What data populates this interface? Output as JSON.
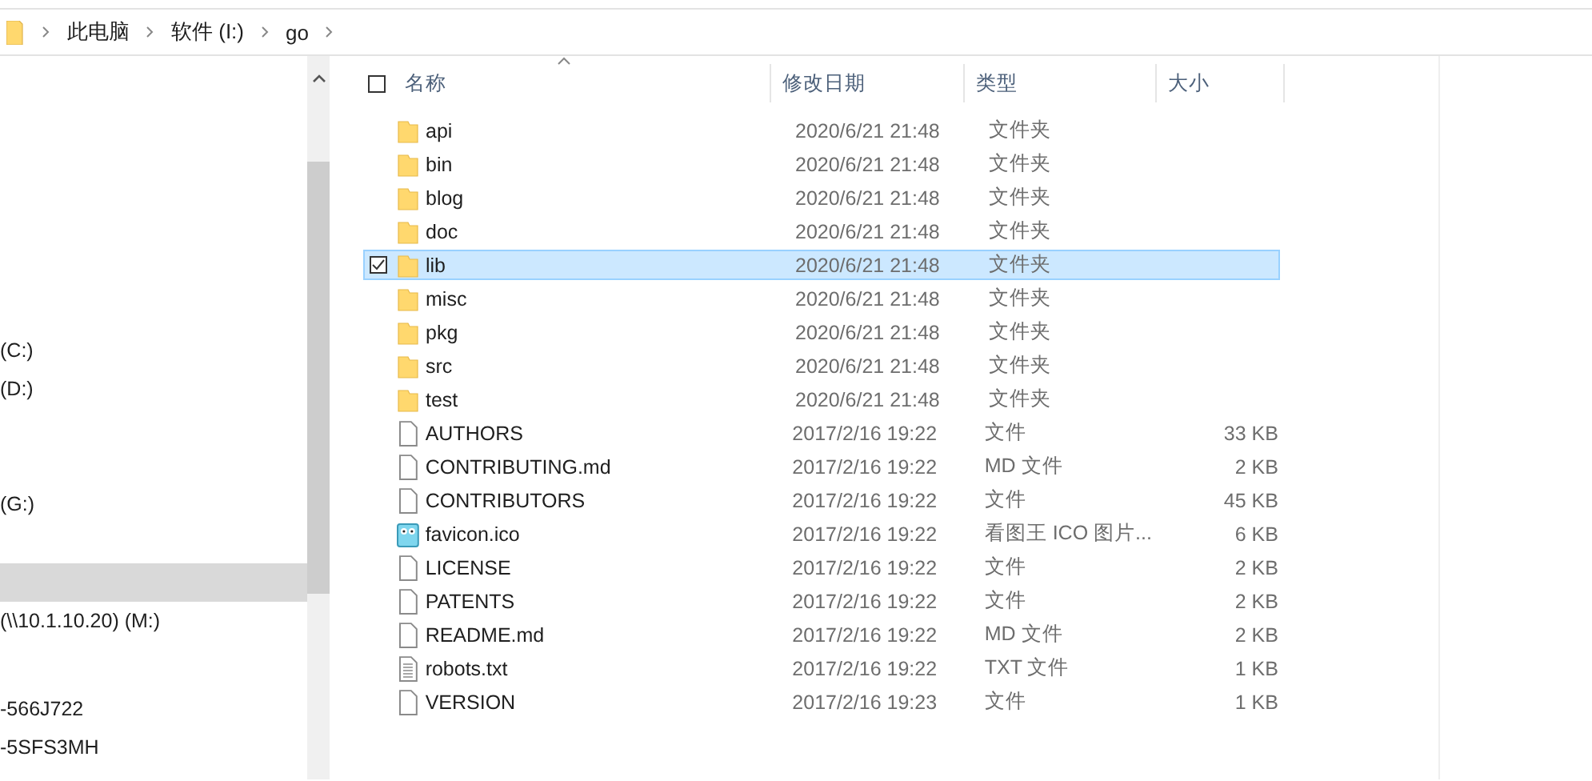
{
  "breadcrumb": [
    "此电脑",
    "软件 (I:)",
    "go"
  ],
  "nav": {
    "items": [
      {
        "label": "(C:)",
        "selected": false
      },
      {
        "label": "(D:)",
        "selected": false
      },
      {
        "label": "(G:)",
        "selected": false
      },
      {
        "selected": true
      },
      {
        "label": "(\\\\10.1.10.20) (M:)",
        "selected": false
      },
      {
        "label": "-566J722",
        "selected": false
      },
      {
        "label": "-5SFS3MH",
        "selected": false
      }
    ]
  },
  "table": {
    "all_checked": false,
    "columns": [
      "名称",
      "修改日期",
      "类型",
      "大小"
    ],
    "rows": [
      {
        "kind": "folder",
        "name": "api",
        "modified": "2020/6/21 21:48",
        "type": "文件夹",
        "selected": false
      },
      {
        "kind": "folder",
        "name": "bin",
        "modified": "2020/6/21 21:48",
        "type": "文件夹",
        "selected": false
      },
      {
        "kind": "folder",
        "name": "blog",
        "modified": "2020/6/21 21:48",
        "type": "文件夹",
        "selected": false
      },
      {
        "kind": "folder",
        "name": "doc",
        "modified": "2020/6/21 21:48",
        "type": "文件夹",
        "selected": false
      },
      {
        "kind": "folder",
        "name": "lib",
        "modified": "2020/6/21 21:48",
        "type": "文件夹",
        "selected": true
      },
      {
        "kind": "folder",
        "name": "misc",
        "modified": "2020/6/21 21:48",
        "type": "文件夹",
        "selected": false
      },
      {
        "kind": "folder",
        "name": "pkg",
        "modified": "2020/6/21 21:48",
        "type": "文件夹",
        "selected": false
      },
      {
        "kind": "folder",
        "name": "src",
        "modified": "2020/6/21 21:48",
        "type": "文件夹",
        "selected": false
      },
      {
        "kind": "folder",
        "name": "test",
        "modified": "2020/6/21 21:48",
        "type": "文件夹",
        "selected": false
      },
      {
        "kind": "file",
        "name": "AUTHORS",
        "modified": "2017/2/16 19:22",
        "type": "文件",
        "size": "33 KB",
        "selected": false
      },
      {
        "kind": "file",
        "name": "CONTRIBUTING.md",
        "modified": "2017/2/16 19:22",
        "type": "MD 文件",
        "size": "2 KB",
        "selected": false
      },
      {
        "kind": "file",
        "name": "CONTRIBUTORS",
        "modified": "2017/2/16 19:22",
        "type": "文件",
        "size": "45 KB",
        "selected": false
      },
      {
        "kind": "image",
        "name": "favicon.ico",
        "modified": "2017/2/16 19:22",
        "type": "看图王 ICO 图片...",
        "size": "6 KB",
        "selected": false
      },
      {
        "kind": "file",
        "name": "LICENSE",
        "modified": "2017/2/16 19:22",
        "type": "文件",
        "size": "2 KB",
        "selected": false
      },
      {
        "kind": "file",
        "name": "PATENTS",
        "modified": "2017/2/16 19:22",
        "type": "文件",
        "size": "2 KB",
        "selected": false
      },
      {
        "kind": "file",
        "name": "README.md",
        "modified": "2017/2/16 19:22",
        "type": "MD 文件",
        "size": "2 KB",
        "selected": false
      },
      {
        "kind": "text",
        "name": "robots.txt",
        "modified": "2017/2/16 19:22",
        "type": "TXT 文件",
        "size": "1 KB",
        "selected": false
      },
      {
        "kind": "file",
        "name": "VERSION",
        "modified": "2017/2/16 19:23",
        "type": "文件",
        "size": "1 KB",
        "selected": false
      }
    ]
  }
}
